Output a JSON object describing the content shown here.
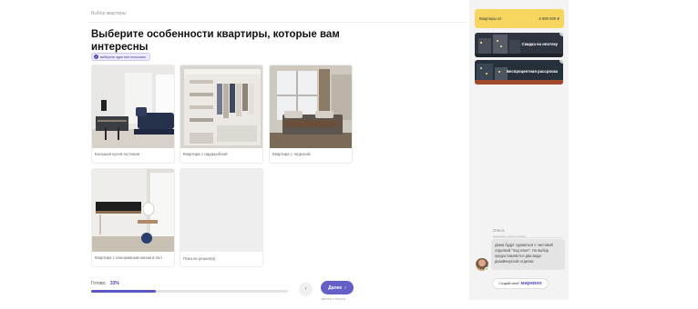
{
  "breadcrumb": "Выбор квартиры",
  "question": {
    "title": "Выберите особенности квартиры, которые вам интересны",
    "hint": "выберите один или несколько"
  },
  "options": [
    {
      "label": "Большая кухня-гостиная",
      "image": "kitchen-living-room"
    },
    {
      "label": "Квартира с гардеробной",
      "image": "wardrobe"
    },
    {
      "label": "Квартира с террасой",
      "image": "bedroom-terrace"
    },
    {
      "label": "Квартира с панорамным окном в пол",
      "image": "panoramic-window-room"
    },
    {
      "label": "Пока не решил(а)",
      "image": "empty-placeholder"
    }
  ],
  "progress": {
    "label": "Готово:",
    "percent_text": "33%",
    "fraction": 0.33
  },
  "nav": {
    "back_symbol": "‹",
    "next_label": "Далее",
    "next_arrow": "›",
    "made_with": "сделано в Marquiz"
  },
  "sidebar": {
    "price": {
      "label": "Квартиры от:",
      "value": "6 600 000 ₽"
    },
    "promos": [
      {
        "label": "Скидка на ипотеку",
        "info": "i"
      },
      {
        "label": "Беспроцентная рассрочка",
        "info": "i"
      }
    ],
    "manager": {
      "name": "Ольга",
      "role": "менеджер отдела продаж",
      "message": "Дома будут сдаваться с чистовой отделкой \"под ключ\". Но выбор предоставляется два вида дизайнерской отделки"
    },
    "create_button": {
      "prefix": "Создай свой",
      "brand": "марквиз"
    }
  },
  "colors": {
    "accent": "#6560c8",
    "price_bg": "#f6d65f",
    "sidebar_bg": "#f3f3f3"
  }
}
